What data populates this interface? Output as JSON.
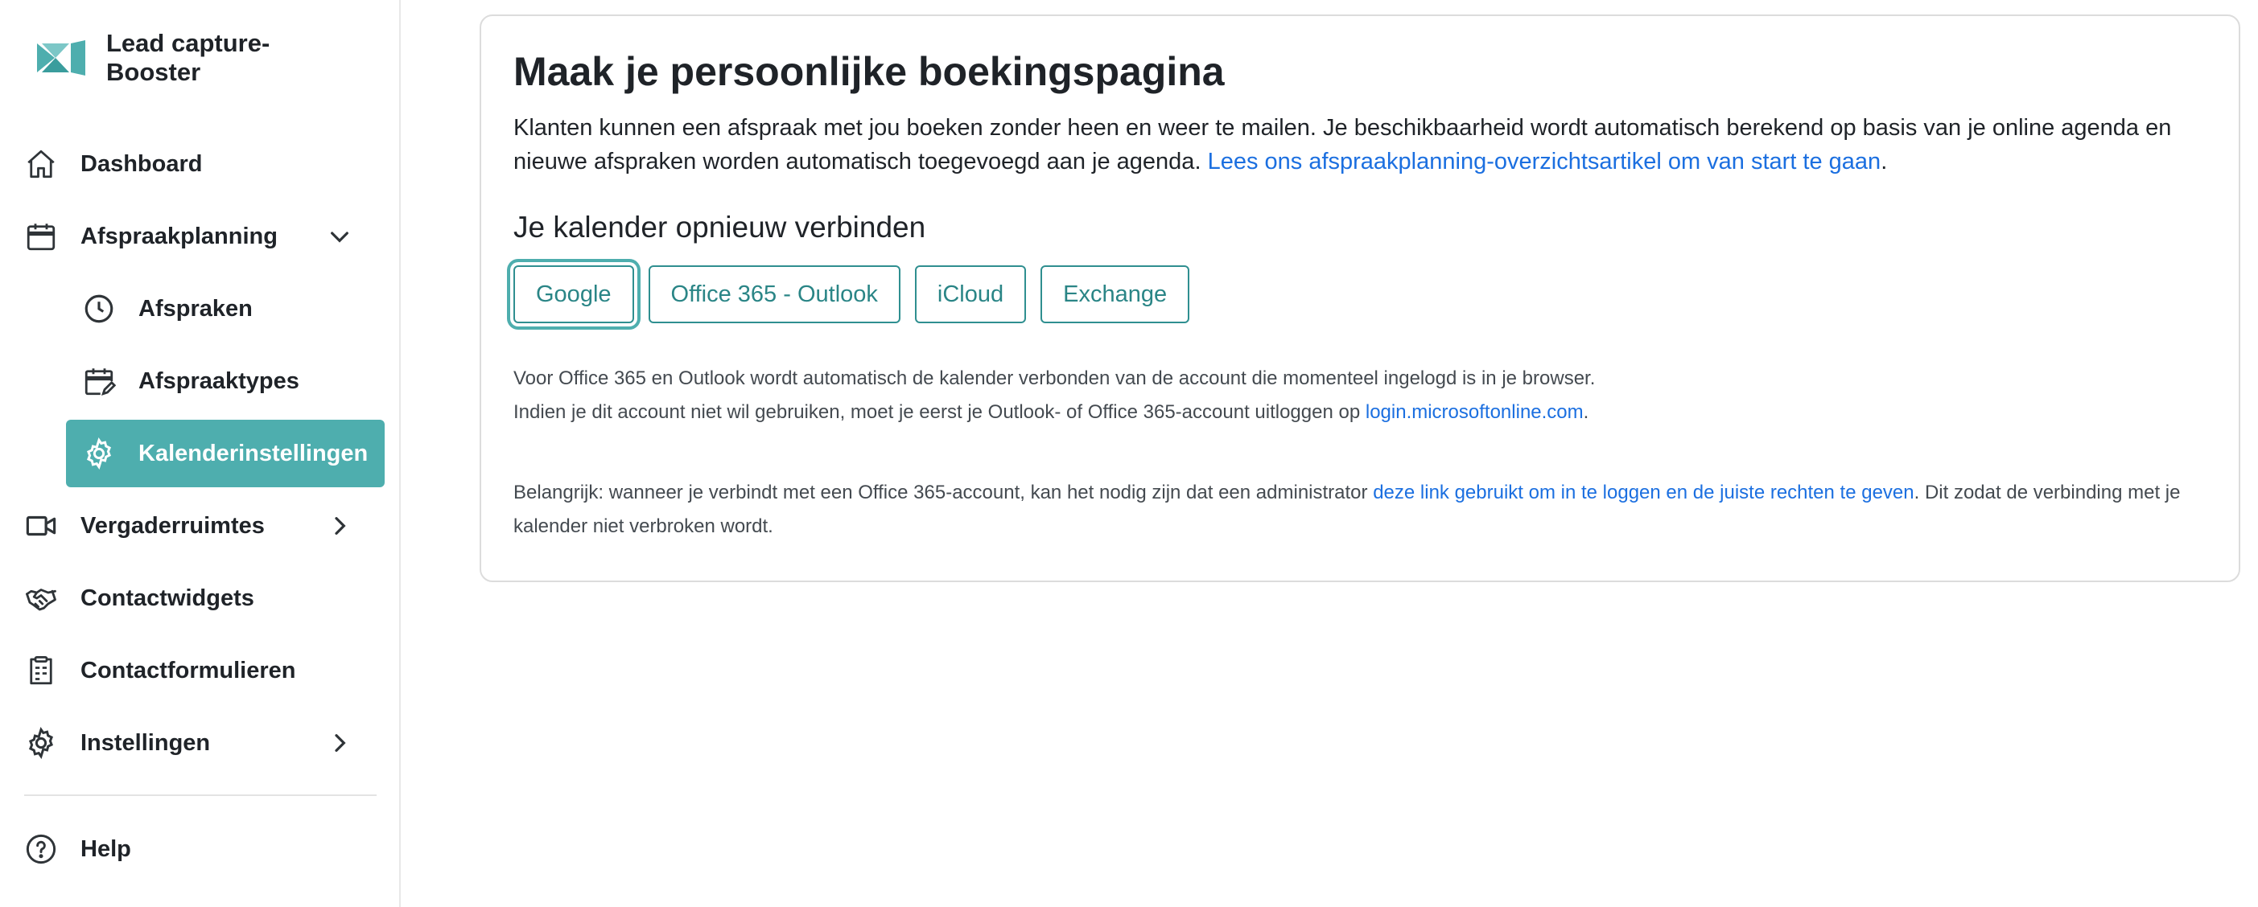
{
  "app": {
    "name": "Lead capture-Booster"
  },
  "sidebar": {
    "items": [
      {
        "label": "Dashboard",
        "icon": "home-icon"
      },
      {
        "label": "Afspraakplanning",
        "icon": "calendar-icon"
      },
      {
        "label": "Afspraken",
        "icon": "clock-icon"
      },
      {
        "label": "Afspraaktypes",
        "icon": "calendar-edit-icon"
      },
      {
        "label": "Kalenderinstellingen",
        "icon": "gear-icon"
      },
      {
        "label": "Vergaderruimtes",
        "icon": "video-icon"
      },
      {
        "label": "Contactwidgets",
        "icon": "handshake-icon"
      },
      {
        "label": "Contactformulieren",
        "icon": "clipboard-icon"
      },
      {
        "label": "Instellingen",
        "icon": "gear-icon"
      },
      {
        "label": "Help",
        "icon": "help-icon"
      }
    ],
    "active_item": "Kalenderinstellingen"
  },
  "main": {
    "title": "Maak je persoonlijke boekingspagina",
    "intro_text": "Klanten kunnen een afspraak met jou boeken zonder heen en weer te mailen. Je beschikbaarheid wordt automatisch berekend op basis van je online agenda en nieuwe afspraken worden automatisch toegevoegd aan je agenda. ",
    "intro_link": "Lees ons afspraakplanning-overzichtsartikel om van start te gaan",
    "intro_end": ".",
    "subtitle": "Je kalender opnieuw verbinden",
    "buttons": [
      "Google",
      "Office 365 - Outlook",
      "iCloud",
      "Exchange"
    ],
    "note1_line1": "Voor Office 365 en Outlook wordt automatisch de kalender verbonden van de account die momenteel ingelogd is in je browser.",
    "note1_line2": "Indien je dit account niet wil gebruiken, moet je eerst je Outlook- of Office 365-account uitloggen op ",
    "note1_link": "login.microsoftonline.com",
    "note1_end": ".",
    "note2_start": "Belangrijk: wanneer je verbindt met een Office 365-account, kan het nodig zijn dat een administrator ",
    "note2_link": "deze link gebruikt om in te loggen en de juiste rechten te geven",
    "note2_end": ". Dit zodat de verbinding met je kalender niet verbroken wordt."
  },
  "colors": {
    "accent": "#4eaeae",
    "link": "#1b6fe0",
    "button_border": "#2f8f90"
  }
}
